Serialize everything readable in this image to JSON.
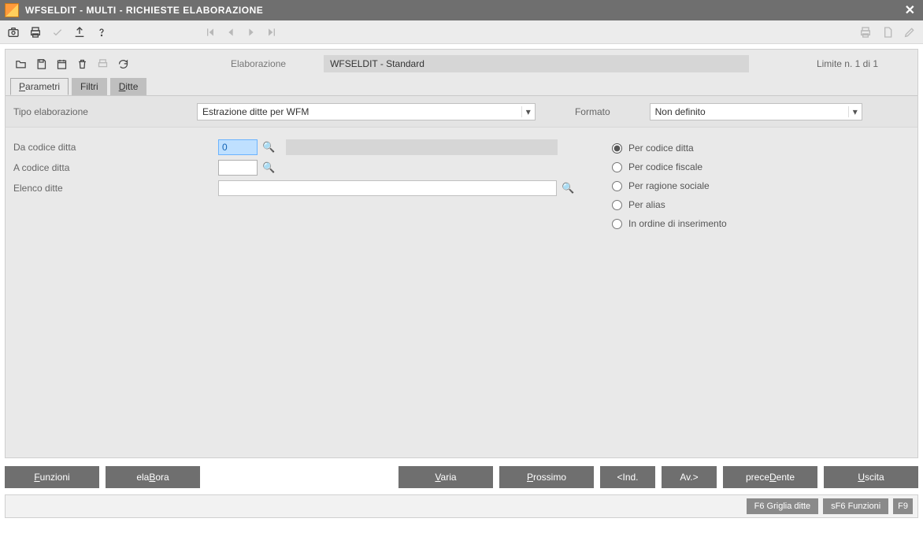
{
  "window": {
    "title": "WFSELDIT  - MULTI -   RICHIESTE ELABORAZIONE"
  },
  "header": {
    "elab_label": "Elaborazione",
    "elab_value": "WFSELDIT - Standard",
    "limit_text": "Limite n. 1 di 1"
  },
  "tabs": {
    "t0": "Parametri",
    "t1": "Filtri",
    "t2": "Ditte"
  },
  "form": {
    "tipo_label": "Tipo elaborazione",
    "tipo_value": "Estrazione ditte per WFM",
    "formato_label": "Formato",
    "formato_value": "Non definito",
    "da_codice_label": "Da codice ditta",
    "da_codice_value": "0",
    "a_codice_label": "A codice ditta",
    "a_codice_value": "",
    "elenco_label": "Elenco ditte",
    "elenco_value": ""
  },
  "radios": {
    "r0": "Per codice ditta",
    "r1": "Per codice fiscale",
    "r2": "Per ragione sociale",
    "r3": "Per alias",
    "r4": "In ordine di inserimento"
  },
  "buttons": {
    "funzioni": "Funzioni",
    "elabora": "elaBora",
    "varia": "Varia",
    "prossimo": "Prossimo",
    "ind": "<Ind.",
    "av": "Av.>",
    "precedente": "preceDente",
    "uscita": "Uscita"
  },
  "status": {
    "griglia": "F6 Griglia ditte",
    "funzioni": "sF6 Funzioni",
    "f9": "F9"
  }
}
